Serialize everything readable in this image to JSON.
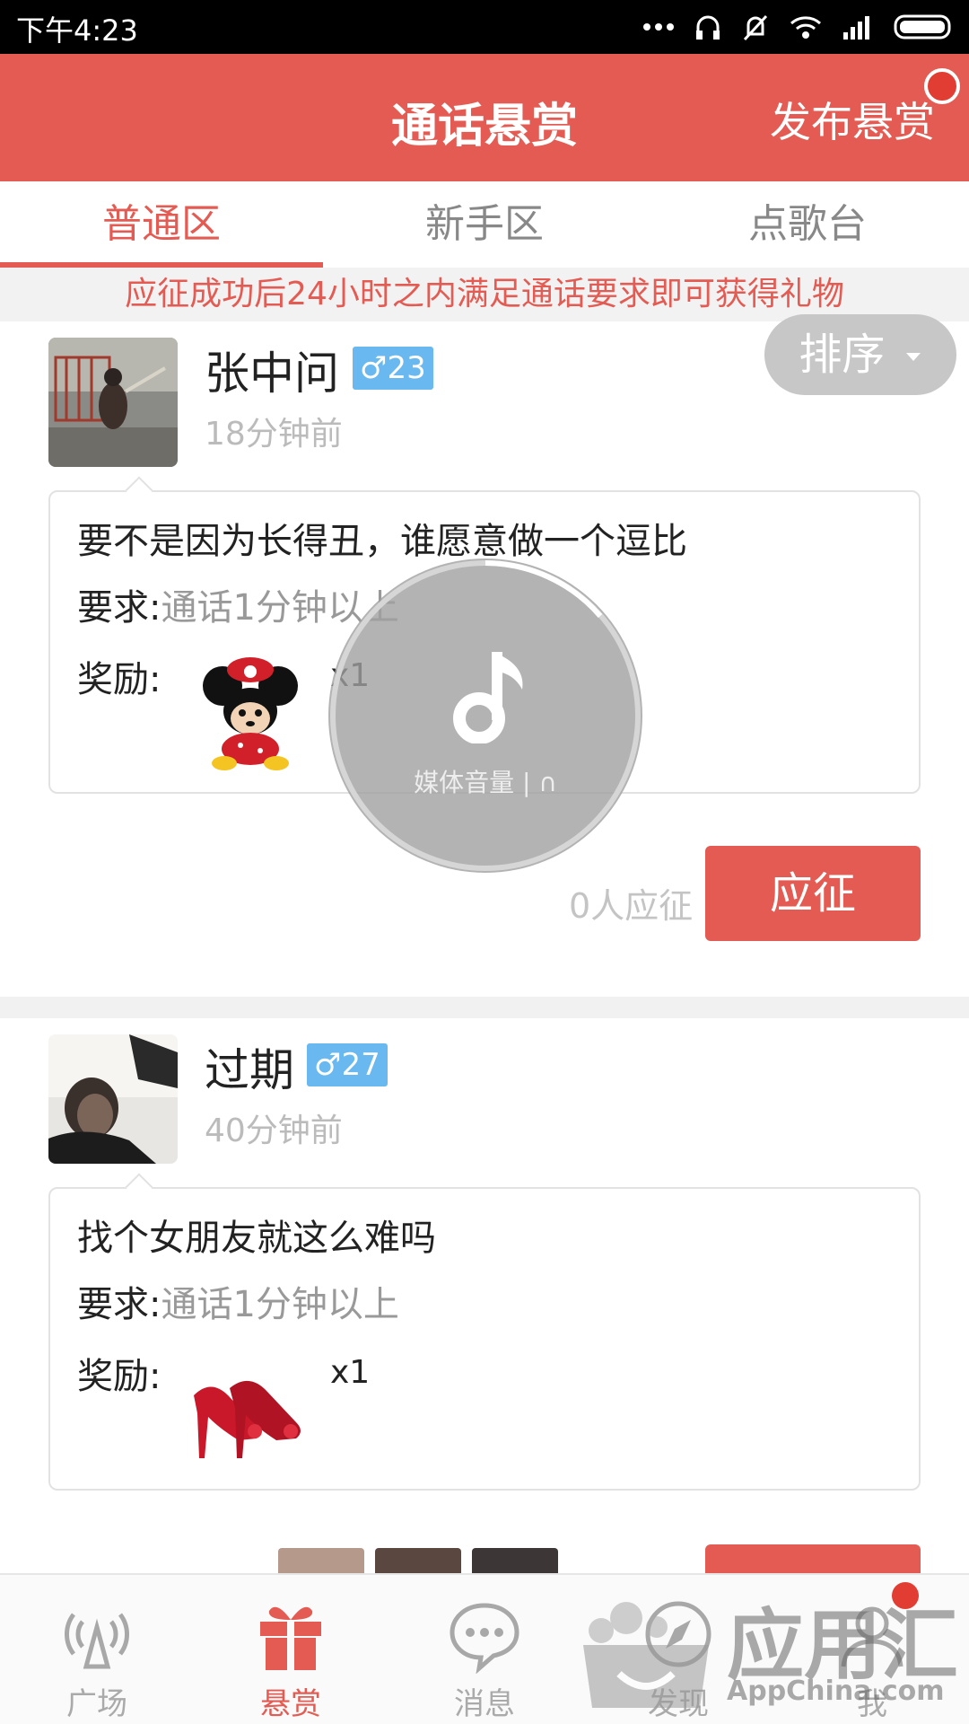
{
  "status_bar": {
    "time": "下午4:23"
  },
  "header": {
    "title": "通话悬赏",
    "publish_label": "发布悬赏"
  },
  "tabs": [
    {
      "label": "普通区",
      "active": true
    },
    {
      "label": "新手区",
      "active": false
    },
    {
      "label": "点歌台",
      "active": false
    }
  ],
  "notice": "应征成功后24小时之内满足通话要求即可获得礼物",
  "sort_label": "排序",
  "posts": [
    {
      "username": "张中问",
      "gender_age": "♂23",
      "time_ago": "18分钟前",
      "message": "要不是因为长得丑，谁愿意做一个逗比",
      "requirement_label": "要求:",
      "requirement_value": "通话1分钟以上",
      "reward_label": "奖励:",
      "reward_gift": "minnie-plush",
      "reward_qty": "x1",
      "applicants": "0人应征",
      "apply_label": "应征"
    },
    {
      "username": "过期",
      "gender_age": "♂27",
      "time_ago": "40分钟前",
      "message": "找个女朋友就这么难吗",
      "requirement_label": "要求:",
      "requirement_value": "通话1分钟以上",
      "reward_label": "奖励:",
      "reward_gift": "red-heels",
      "reward_qty": "x1"
    }
  ],
  "volume_overlay": {
    "label": "媒体音量 | ∩"
  },
  "bottom_nav": [
    {
      "label": "广场",
      "icon": "broadcast-icon",
      "active": false
    },
    {
      "label": "悬赏",
      "icon": "gift-icon",
      "active": true
    },
    {
      "label": "消息",
      "icon": "chat-bubble-icon",
      "active": false
    },
    {
      "label": "发现",
      "icon": "compass-icon",
      "active": false
    },
    {
      "label": "我",
      "icon": "user-icon",
      "active": false
    }
  ],
  "watermark": {
    "brand": "应用汇",
    "sub": "AppChina.com"
  },
  "colors": {
    "accent": "#e35b52",
    "gender_badge": "#69b8f0"
  }
}
